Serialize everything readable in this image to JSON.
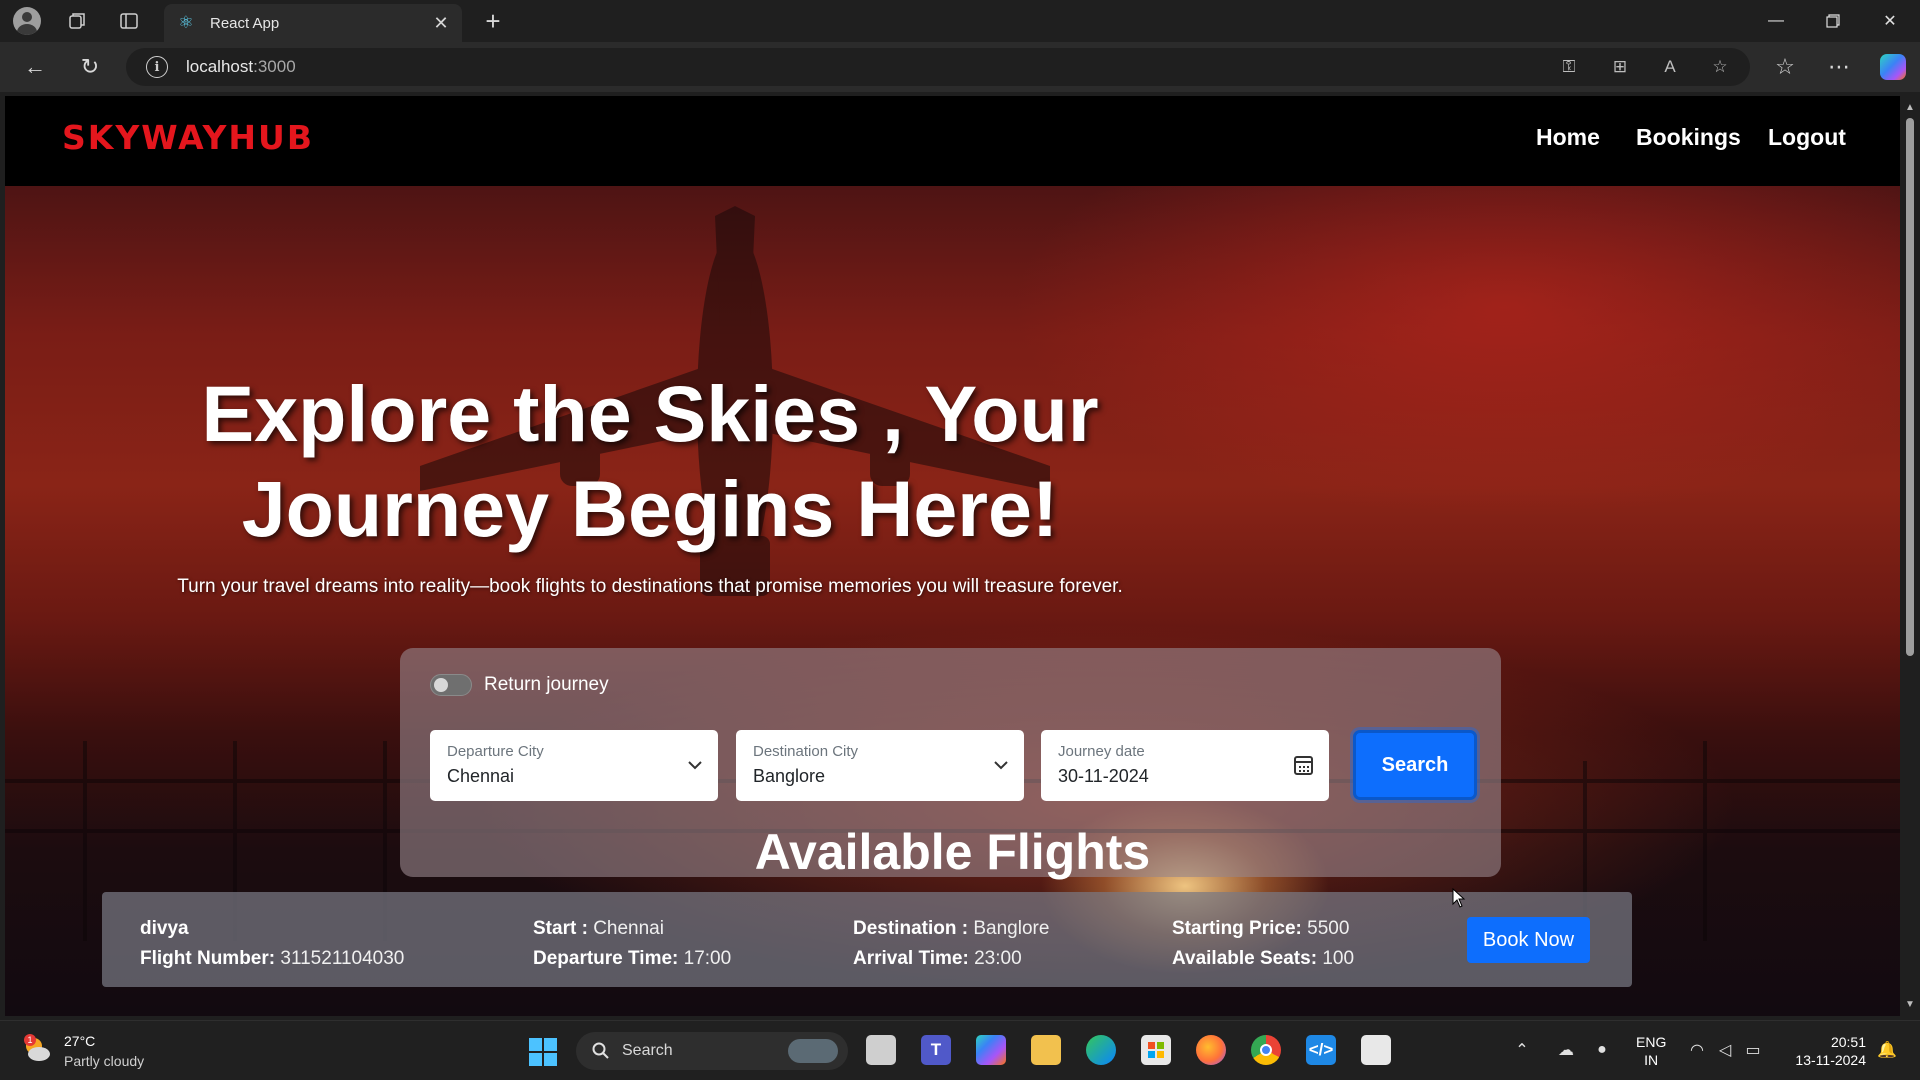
{
  "browser": {
    "tab_title": "React App",
    "address_host": "localhost",
    "address_port": ":3000"
  },
  "site": {
    "logo": "SKYWAYHUB",
    "nav": [
      "Home",
      "Bookings",
      "Logout"
    ]
  },
  "hero": {
    "title_line1": "Explore the Skies , Your",
    "title_line2": "Journey Begins Here!",
    "subtitle": "Turn your travel dreams into reality—book flights to destinations that promise memories you will treasure forever."
  },
  "search_form": {
    "toggle_label": "Return journey",
    "departure": {
      "label": "Departure City",
      "value": "Chennai"
    },
    "destination": {
      "label": "Destination City",
      "value": "Banglore"
    },
    "journey_date": {
      "label": "Journey date",
      "value": "30-11-2024"
    },
    "search_label": "Search"
  },
  "flights": {
    "heading": "Available Flights",
    "items": [
      {
        "airline": "divya",
        "flight_number_label": "Flight Number:",
        "flight_number": "311521104030",
        "start_label": "Start :",
        "start": "Chennai",
        "departure_time_label": "Departure Time:",
        "departure_time": "17:00",
        "destination_label": "Destination :",
        "destination": "Banglore",
        "arrival_time_label": "Arrival Time:",
        "arrival_time": "23:00",
        "price_label": "Starting Price:",
        "price": "5500",
        "seats_label": "Available Seats:",
        "seats": "100",
        "book_label": "Book Now"
      }
    ]
  },
  "taskbar": {
    "weather_badge": "1",
    "temperature": "27°C",
    "condition": "Partly cloudy",
    "search_label": "Search",
    "lang_line1": "ENG",
    "lang_line2": "IN",
    "time": "20:51",
    "date": "13-11-2024"
  },
  "colors": {
    "brand_red": "#e4161d",
    "primary_blue": "#0d6efd",
    "header_bg": "#000000"
  },
  "icons": {
    "browser": [
      "profile-icon",
      "workspaces-icon",
      "tab-actions-icon",
      "react-favicon-icon",
      "close-icon",
      "plus-icon",
      "minimize-icon",
      "restore-icon",
      "back-icon",
      "refresh-icon",
      "info-icon",
      "key-icon",
      "apps-icon",
      "read-aloud-icon",
      "star-icon",
      "favorites-icon",
      "more-icon",
      "copilot-icon"
    ],
    "taskbar": [
      "weather-icon",
      "windows-start-icon",
      "search-icon",
      "task-view-icon",
      "teams-icon",
      "copilot-app-icon",
      "file-explorer-icon",
      "edge-icon",
      "store-icon",
      "firefox-icon",
      "chrome-icon",
      "vscode-icon",
      "snipping-tool-icon",
      "chevron-up-icon",
      "onedrive-icon",
      "mic-icon",
      "wifi-icon",
      "volume-muted-icon",
      "battery-icon",
      "notification-bell-icon"
    ]
  }
}
